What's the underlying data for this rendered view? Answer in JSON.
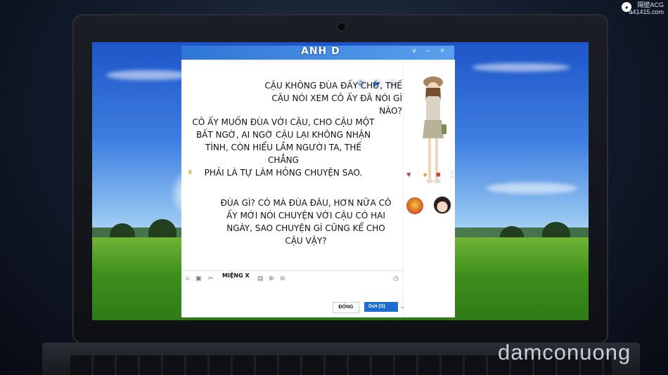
{
  "overlay": {
    "site_name": "隔壁ACG",
    "site_url": "a41415.com",
    "bottom_watermark": "damconuong"
  },
  "chat": {
    "title": "ANH D",
    "window_controls": [
      "v",
      "–",
      "×"
    ],
    "messages": [
      {
        "id": "m1",
        "lines": [
          "Cậu không đùa đấy chứ, thế",
          "cậu nói xem cô ấy đã nói gì nào?"
        ]
      },
      {
        "id": "m2",
        "lines": [
          "Cô ấy muốn đùa với cậu, cho cậu một",
          "bất ngờ, ai ngờ cậu lại không nhận",
          "tình, còn hiểu lầm người ta, thế chẳng",
          "phải là tự làm hỏng chuyện sao."
        ]
      },
      {
        "id": "m3",
        "lines": [
          "Đùa gì? Có mà đùa đâu, hơn nữa cô",
          "ấy mới nói chuyện với cậu có hai",
          "ngày, sao chuyện gì cũng kể cho",
          "cậu vậy?"
        ]
      }
    ],
    "toolbar_label": "miệng x",
    "close_label": "Đóng",
    "send_label": "Gửi (S)"
  },
  "colors": {
    "title_bar": "#2e76d6",
    "send_button": "#1d6ccf"
  },
  "icons": [
    "phone-icon",
    "video-icon",
    "more-icon",
    "smile-icon",
    "gif-icon",
    "scissors-icon",
    "clock-icon",
    "heart-icon",
    "gift-icon"
  ]
}
